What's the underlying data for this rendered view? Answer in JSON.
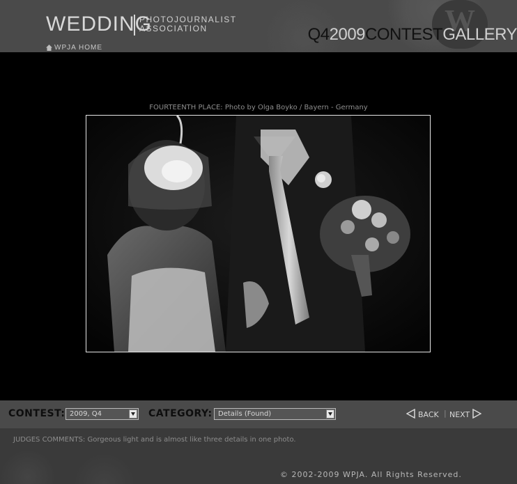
{
  "header": {
    "logo_main": "WEDDING",
    "logo_sub_line1": "PHOTOJOURNALIST",
    "logo_sub_line2": "ASSOCIATION",
    "home_link": "WPJA HOME",
    "seal_letter": "W",
    "gallery_title": {
      "quarter": "Q4",
      "year": "2009",
      "contest": "CONTEST",
      "gallery": "GALLERY"
    }
  },
  "photo": {
    "caption": "FOURTEENTH PLACE: Photo by Olga Boyko / Bayern - Germany"
  },
  "controls": {
    "contest_label": "CONTEST:",
    "contest_value": "2009, Q4",
    "category_label": "CATEGORY:",
    "category_value": "Details (Found)",
    "back_label": "BACK",
    "separator": "|",
    "next_label": "NEXT"
  },
  "footer": {
    "comments": "JUDGES COMMENTS: Gorgeous light and is almost like three details in one photo.",
    "copyright": "© 2002-2009 WPJA. All Rights Reserved."
  },
  "colors": {
    "header_bg": "#4a4a4a",
    "page_bg": "#000000",
    "footer_bg": "#3a3a3a"
  }
}
